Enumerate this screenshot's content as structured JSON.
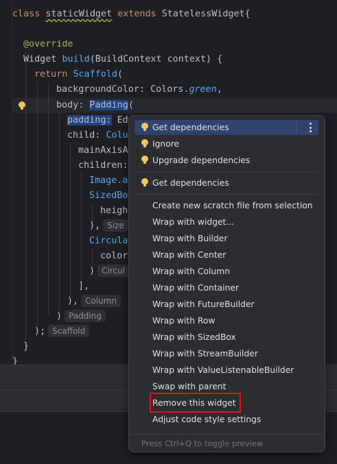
{
  "code": {
    "line1": {
      "kw": "class",
      "name": "staticWidget",
      "kw2": "extends",
      "base": "StatelessWidget{"
    },
    "line2": {
      "annotation": "@override"
    },
    "line3": {
      "type": "Widget",
      "fn": "build",
      "params": "(BuildContext context) {"
    },
    "line4": {
      "kw": "return",
      "fn": "Scaffold",
      "rest": "("
    },
    "line5": {
      "named": "backgroundColor:",
      "cls": "Colors.",
      "val": "green",
      "rest": ","
    },
    "line6": {
      "named": "body:",
      "fn": "Padding",
      "rest": "("
    },
    "line7": {
      "named": "padding:",
      "rest": "Ed"
    },
    "line8": {
      "named": "child:",
      "fn": "Colu"
    },
    "line9": {
      "named": "mainAxisA"
    },
    "line10": {
      "named": "children:"
    },
    "line11": {
      "fn": "Image.a"
    },
    "line12": {
      "fn": "SizedBo"
    },
    "line13": {
      "named": "heigh"
    },
    "line14": {
      "rest": "),",
      "hint": "Size"
    },
    "line15": {
      "fn": "Circula"
    },
    "line16": {
      "named": "color"
    },
    "line17": {
      "rest": ")",
      "hint": "Circul"
    },
    "line18": {
      "rest": "],"
    },
    "line19": {
      "rest": "),",
      "hint": "Column"
    },
    "line20": {
      "rest": ")",
      "hint": "Padding"
    },
    "line21": {
      "rest": ");",
      "hint": "Scaffold"
    },
    "line22": {
      "rest": "}"
    },
    "line23": {
      "rest": "}"
    }
  },
  "popup": {
    "items": [
      {
        "label": "Get dependencies",
        "icon": "lightbulb-icon"
      },
      {
        "label": "Ignore",
        "icon": "lightbulb-icon"
      },
      {
        "label": "Upgrade dependencies",
        "icon": "lightbulb-icon"
      },
      {
        "label": "Get dependencies",
        "icon": "lightbulb-icon"
      },
      {
        "label": "Create new scratch file from selection"
      },
      {
        "label": "Wrap with widget..."
      },
      {
        "label": "Wrap with Builder"
      },
      {
        "label": "Wrap with Center"
      },
      {
        "label": "Wrap with Column"
      },
      {
        "label": "Wrap with Container"
      },
      {
        "label": "Wrap with FutureBuilder"
      },
      {
        "label": "Wrap with Row"
      },
      {
        "label": "Wrap with SizedBox"
      },
      {
        "label": "Wrap with StreamBuilder"
      },
      {
        "label": "Wrap with ValueListenableBuilder"
      },
      {
        "label": "Swap with parent"
      },
      {
        "label": "Remove this widget"
      },
      {
        "label": "Adjust code style settings"
      }
    ],
    "footer": "Press Ctrl+Q to toggle preview"
  },
  "colors": {
    "selection": "#2e436e",
    "highlight_box": "#e3141b",
    "bulb": "#f2c55c"
  }
}
